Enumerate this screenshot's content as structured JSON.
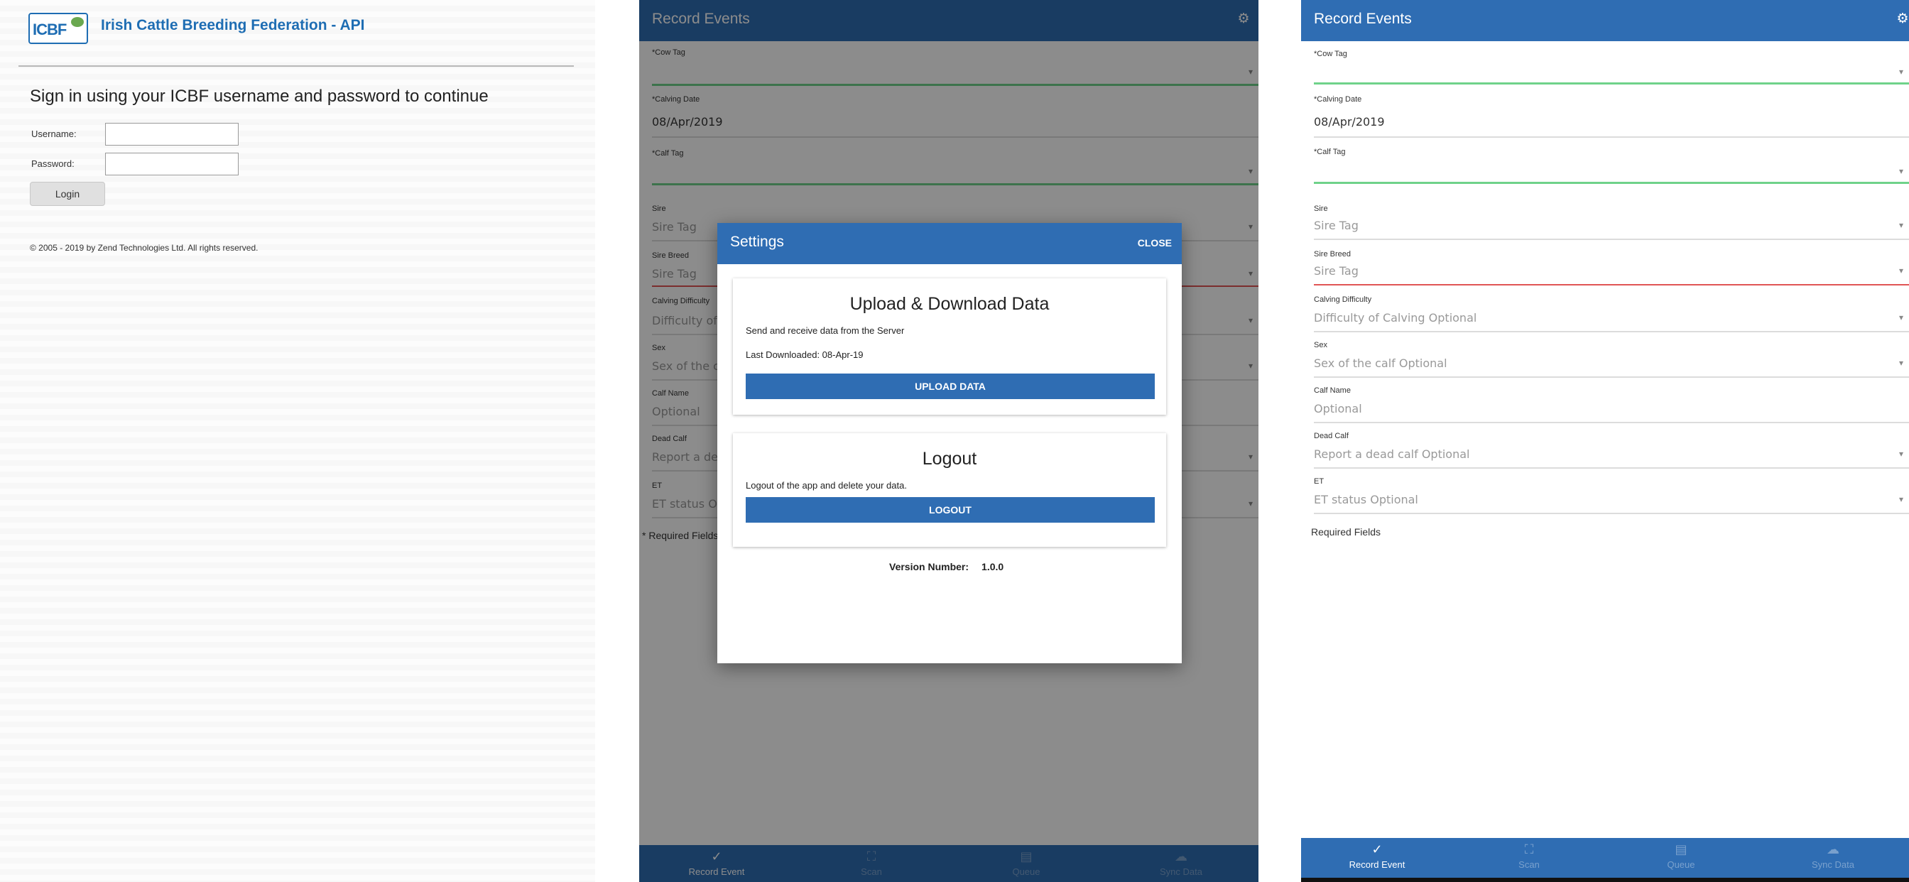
{
  "login": {
    "logo_text": "ICBF",
    "site_title": "Irish Cattle Breeding Federation - API",
    "heading": "Sign in using your ICBF username and password to continue",
    "username_label": "Username:",
    "password_label": "Password:",
    "username_value": "",
    "password_value": "",
    "login_button": "Login",
    "copyright": "© 2005 - 2019 by Zend Technologies Ltd. All rights reserved."
  },
  "app": {
    "title": "Record Events",
    "fields": [
      {
        "label": "*Cow Tag",
        "value": ""
      },
      {
        "label": "*Calving Date",
        "value": "08/Apr/2019"
      },
      {
        "label": "*Calf Tag",
        "value": ""
      },
      {
        "label": "Sire",
        "value": "Sire Tag"
      },
      {
        "label": "Sire Breed",
        "value": "Sire Tag"
      },
      {
        "label": "Calving Difficulty",
        "value": "Difficulty of Calving Optional"
      },
      {
        "label": "Sex",
        "value": "Sex of the calf Optional"
      },
      {
        "label": "Calf Name",
        "value": "Optional"
      },
      {
        "label": "Dead Calf",
        "value": "Report a dead calf Optional"
      },
      {
        "label": "ET",
        "value": "ET status Optional"
      }
    ],
    "required_note_settings": "* Required Fields",
    "required_note": "Required Fields",
    "nav": [
      {
        "label": "Record Event",
        "icon": "check-icon"
      },
      {
        "label": "Scan",
        "icon": "scan-icon"
      },
      {
        "label": "Queue",
        "icon": "queue-icon"
      },
      {
        "label": "Sync Data",
        "icon": "cloud-icon"
      }
    ]
  },
  "settings": {
    "title": "Settings",
    "close": "CLOSE",
    "upload_card": {
      "heading": "Upload & Download Data",
      "description": "Send and receive data from the Server",
      "last_downloaded": "Last Downloaded: 08-Apr-19",
      "button": "UPLOAD DATA"
    },
    "logout_card": {
      "heading": "Logout",
      "description": "Logout of the app and delete your data.",
      "button": "LOGOUT"
    },
    "version_label": "Version Number:",
    "version_value": "1.0.0"
  },
  "colors": {
    "primary": "#2f6db3",
    "valid_underline": "#6fd28a",
    "error_underline": "#e05555"
  }
}
